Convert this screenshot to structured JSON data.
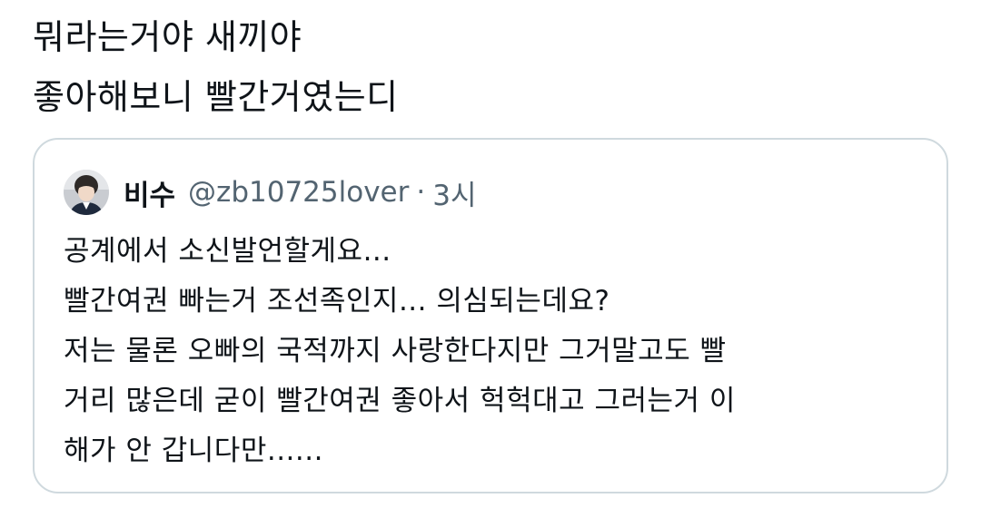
{
  "tweet": {
    "lines": [
      "뭐라는거야 새끼야",
      "좋아해보니 빨간거였는디"
    ]
  },
  "quote": {
    "display_name": "비수",
    "handle": "@zb10725lover",
    "separator": "·",
    "time": "3시",
    "avatar_icon": "profile-photo",
    "lines": [
      "공계에서 소신발언할게요...",
      "빨간여권 빠는거 조선족인지... 의심되는데요?",
      "저는 물론 오빠의 국적까지 사랑한다지만 그거말고도 빨",
      "거리 많은데 굳이 빨간여권 좋아서 헉헉대고 그러는거 이",
      "해가 안 갑니다만......"
    ]
  },
  "colors": {
    "text": "#0f1419",
    "secondary": "#536471",
    "border": "#cfd9de"
  }
}
